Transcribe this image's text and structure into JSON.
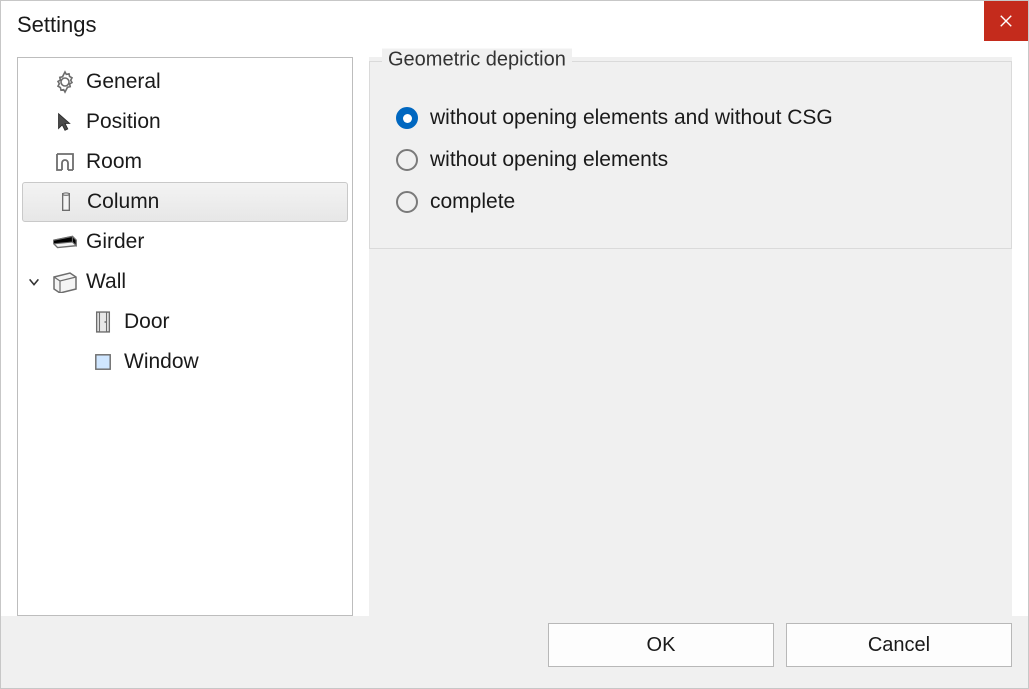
{
  "title": "Settings",
  "tree": {
    "general": "General",
    "position": "Position",
    "room": "Room",
    "column": "Column",
    "girder": "Girder",
    "wall": "Wall",
    "door": "Door",
    "window": "Window"
  },
  "group": {
    "title": "Geometric depiction",
    "opt1": "without opening elements and without CSG",
    "opt2": "without opening elements",
    "opt3": "complete"
  },
  "buttons": {
    "ok": "OK",
    "cancel": "Cancel"
  }
}
